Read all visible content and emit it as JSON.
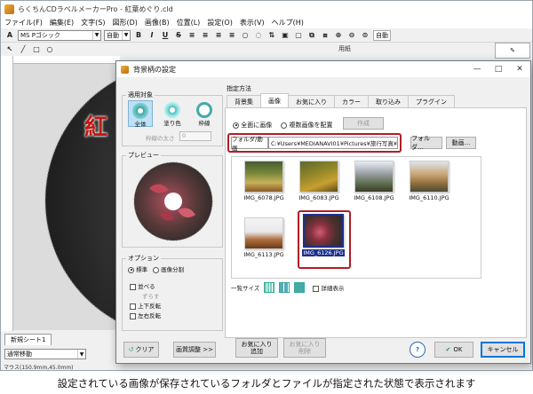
{
  "app": {
    "title": "らくちんCDラベルメーカーPro - 紅葉めぐり.cld",
    "menu": [
      "ファイル(F)",
      "編集(E)",
      "文字(S)",
      "図形(D)",
      "画像(B)",
      "位置(L)",
      "設定(O)",
      "表示(V)",
      "ヘルプ(H)"
    ],
    "font_name": "MS Pゴシック",
    "font_size": "自動",
    "auto_label": "自動",
    "print_label": "印刷",
    "paper_label": "用紙",
    "sheet_tab": "新規シート1",
    "snap_mode": "通常移動",
    "status": "マウス(150.9mm,45.0mm)",
    "disc_text": "紅"
  },
  "dialog": {
    "title": "背景柄の設定",
    "target_group": "適用対象",
    "targets": [
      "全体",
      "塗り色",
      "枠線"
    ],
    "border_width_label": "枠線の太さ",
    "border_width_value": "0",
    "preview_label": "プレビュー",
    "options_group": "オプション",
    "option_radios": [
      "標準",
      "画像分割"
    ],
    "option_checks": [
      "並べる",
      "ずらす",
      "上下反転",
      "左右反転"
    ],
    "method_label": "指定方法",
    "tabs": [
      "背景集",
      "画像",
      "お気に入り",
      "カラー",
      "取り込み",
      "プラグイン"
    ],
    "selected_tab": "画像",
    "radio_whole": "全面に画像",
    "radio_multi": "複数画像を配置",
    "create_button": "作成",
    "folder_file_label": "フォルダ/動画",
    "path": "C:¥Users¥MEDIANAVI01¥Pictures¥旅行写真¥",
    "folder_button": "フォルダ...",
    "video_button": "動画...",
    "thumbnails": [
      "IMG_6078.JPG",
      "IMG_6083.JPG",
      "IMG_6108.JPG",
      "IMG_6110.JPG",
      "IMG_6113.JPG",
      "IMG_6126.JPG"
    ],
    "selected_thumbnail": "IMG_6126.JPG",
    "thumb_size_label": "一覧サイズ",
    "detail_check": "詳細表示",
    "clear_button": "クリア",
    "adjust_button": "画質調整 >>",
    "fav_add_button": [
      "お気に入り",
      "追加"
    ],
    "fav_del_button": [
      "お気に入り",
      "削除"
    ],
    "help_button": "?",
    "ok_button": "OK",
    "cancel_button": "キャンセル"
  },
  "caption": "設定されている画像が保存されているフォルダとファイルが指定された状態で表示されます",
  "colors": {
    "highlight_red": "#b01d25",
    "selection_blue": "#1c2f8c",
    "disc_dark": "#2a2a2a"
  }
}
